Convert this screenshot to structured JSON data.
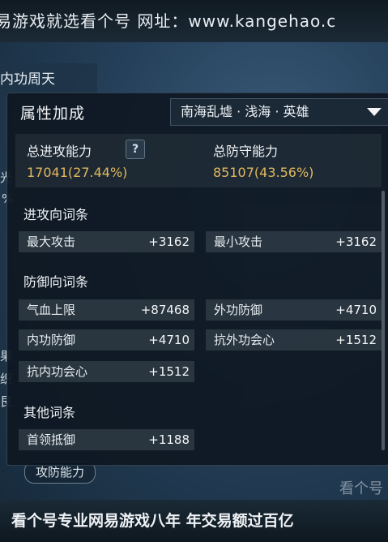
{
  "banner_top": "易游戏就选看个号  网址：www.kangehao.c",
  "banner_bottom": "看个号专业网易游戏八年  年交易额过百亿",
  "background": {
    "tab_label": "内功周天",
    "frag_1": "光",
    "frag_2": "%",
    "frag_3": "果",
    "frag_4": "织",
    "frag_5": "艮",
    "button_label": "攻防能力",
    "watermark": "看个号"
  },
  "panel": {
    "title": "属性加成",
    "dropdown": {
      "selected": "南海乱墟 · 浅海 · 英雄",
      "icon": "triangle-down"
    },
    "summary": {
      "attack_label": "总进攻能力",
      "attack_value": "17041(27.44%)",
      "defense_label": "总防守能力",
      "defense_value": "85107(43.56%)",
      "value_color": "#e3b95d"
    },
    "sections": {
      "attack": {
        "title": "进攻向词条",
        "rows": [
          {
            "label": "最大攻击",
            "value": "+3162"
          },
          {
            "label": "最小攻击",
            "value": "+3162"
          }
        ]
      },
      "defense": {
        "title": "防御向词条",
        "rows": [
          {
            "label": "气血上限",
            "value": "+87468"
          },
          {
            "label": "外功防御",
            "value": "+4710"
          },
          {
            "label": "内功防御",
            "value": "+4710"
          },
          {
            "label": "抗外功会心",
            "value": "+1512"
          },
          {
            "label": "抗内功会心",
            "value": "+1512"
          }
        ]
      },
      "other": {
        "title": "其他词条",
        "rows": [
          {
            "label": "首领抵御",
            "value": "+1188"
          }
        ]
      }
    }
  }
}
